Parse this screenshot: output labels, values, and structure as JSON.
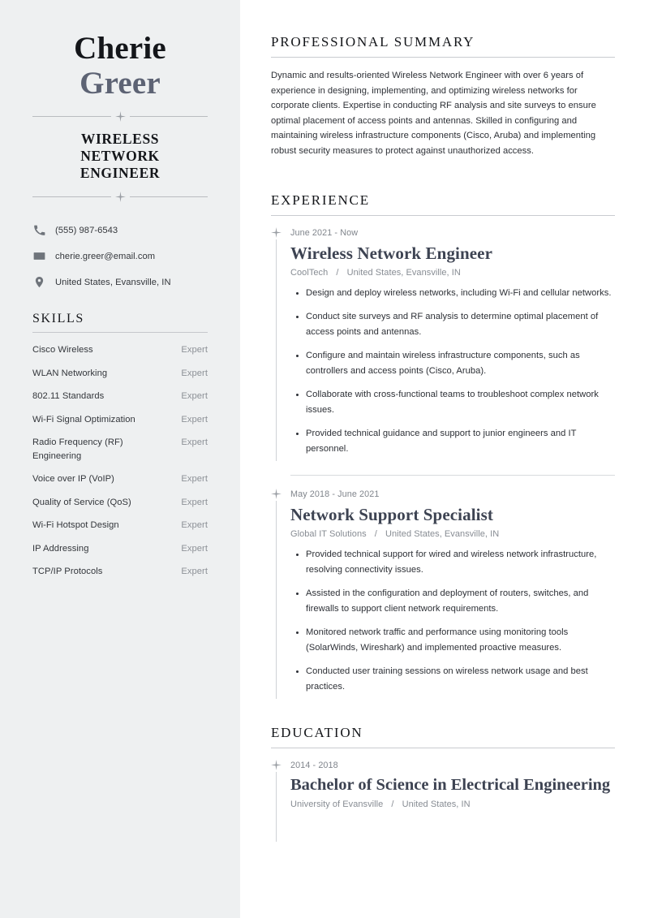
{
  "profile": {
    "first_name": "Cherie",
    "last_name": "Greer",
    "headline": "WIRELESS\nNETWORK\nENGINEER",
    "headline_lines": [
      "WIRELESS",
      "NETWORK",
      "ENGINEER"
    ]
  },
  "colors": {
    "sidebar_bg": "#eef0f1",
    "page_bg": "#ffffff",
    "name_primary": "#14161a",
    "name_accent": "#5d6374",
    "heading": "#14161a",
    "body_text": "#2d3036",
    "muted_text": "#8d9197",
    "job_title": "#3d4352",
    "rule": "#c9ccd0"
  },
  "contact": {
    "items": [
      {
        "icon": "phone-icon",
        "value": "(555) 987-6543"
      },
      {
        "icon": "envelope-icon",
        "value": "cherie.greer@email.com"
      },
      {
        "icon": "location-pin-icon",
        "value": "United States, Evansville, IN"
      }
    ]
  },
  "skills": {
    "title": "SKILLS",
    "items": [
      {
        "name": "Cisco Wireless",
        "level": "Expert"
      },
      {
        "name": "WLAN Networking",
        "level": "Expert"
      },
      {
        "name": "802.11 Standards",
        "level": "Expert"
      },
      {
        "name": "Wi-Fi Signal Optimization",
        "level": "Expert"
      },
      {
        "name": "Radio Frequency (RF) Engineering",
        "level": "Expert"
      },
      {
        "name": "Voice over IP (VoIP)",
        "level": "Expert"
      },
      {
        "name": "Quality of Service (QoS)",
        "level": "Expert"
      },
      {
        "name": "Wi-Fi Hotspot Design",
        "level": "Expert"
      },
      {
        "name": "IP Addressing",
        "level": "Expert"
      },
      {
        "name": "TCP/IP Protocols",
        "level": "Expert"
      }
    ]
  },
  "summary": {
    "title": "PROFESSIONAL SUMMARY",
    "text": "Dynamic and results-oriented Wireless Network Engineer with over 6 years of experience in designing, implementing, and optimizing wireless networks for corporate clients. Expertise in conducting RF analysis and site surveys to ensure optimal placement of access points and antennas. Skilled in configuring and maintaining wireless infrastructure components (Cisco, Aruba) and implementing robust security measures to protect against unauthorized access."
  },
  "experience": {
    "title": "EXPERIENCE",
    "entries": [
      {
        "date": "June 2021 - Now",
        "title": "Wireless Network Engineer",
        "company": "CoolTech",
        "separator": "/",
        "location": "United States, Evansville, IN",
        "bullets": [
          "Design and deploy wireless networks, including Wi-Fi and cellular networks.",
          "Conduct site surveys and RF analysis to determine optimal placement of access points and antennas.",
          "Configure and maintain wireless infrastructure components, such as controllers and access points (Cisco, Aruba).",
          "Collaborate with cross-functional teams to troubleshoot complex network issues.",
          "Provided technical guidance and support to junior engineers and IT personnel."
        ]
      },
      {
        "date": "May 2018 - June 2021",
        "title": "Network Support Specialist",
        "company": "Global IT Solutions",
        "separator": "/",
        "location": "United States, Evansville, IN",
        "bullets": [
          "Provided technical support for wired and wireless network infrastructure, resolving connectivity issues.",
          "Assisted in the configuration and deployment of routers, switches, and firewalls to support client network requirements.",
          "Monitored network traffic and performance using monitoring tools (SolarWinds, Wireshark) and implemented proactive measures.",
          "Conducted user training sessions on wireless network usage and best practices."
        ]
      }
    ]
  },
  "education": {
    "title": "EDUCATION",
    "entries": [
      {
        "date": "2014 - 2018",
        "title": "Bachelor of Science in Electrical Engineering",
        "school": "University of Evansville",
        "separator": "/",
        "location": "United States, IN"
      }
    ]
  }
}
